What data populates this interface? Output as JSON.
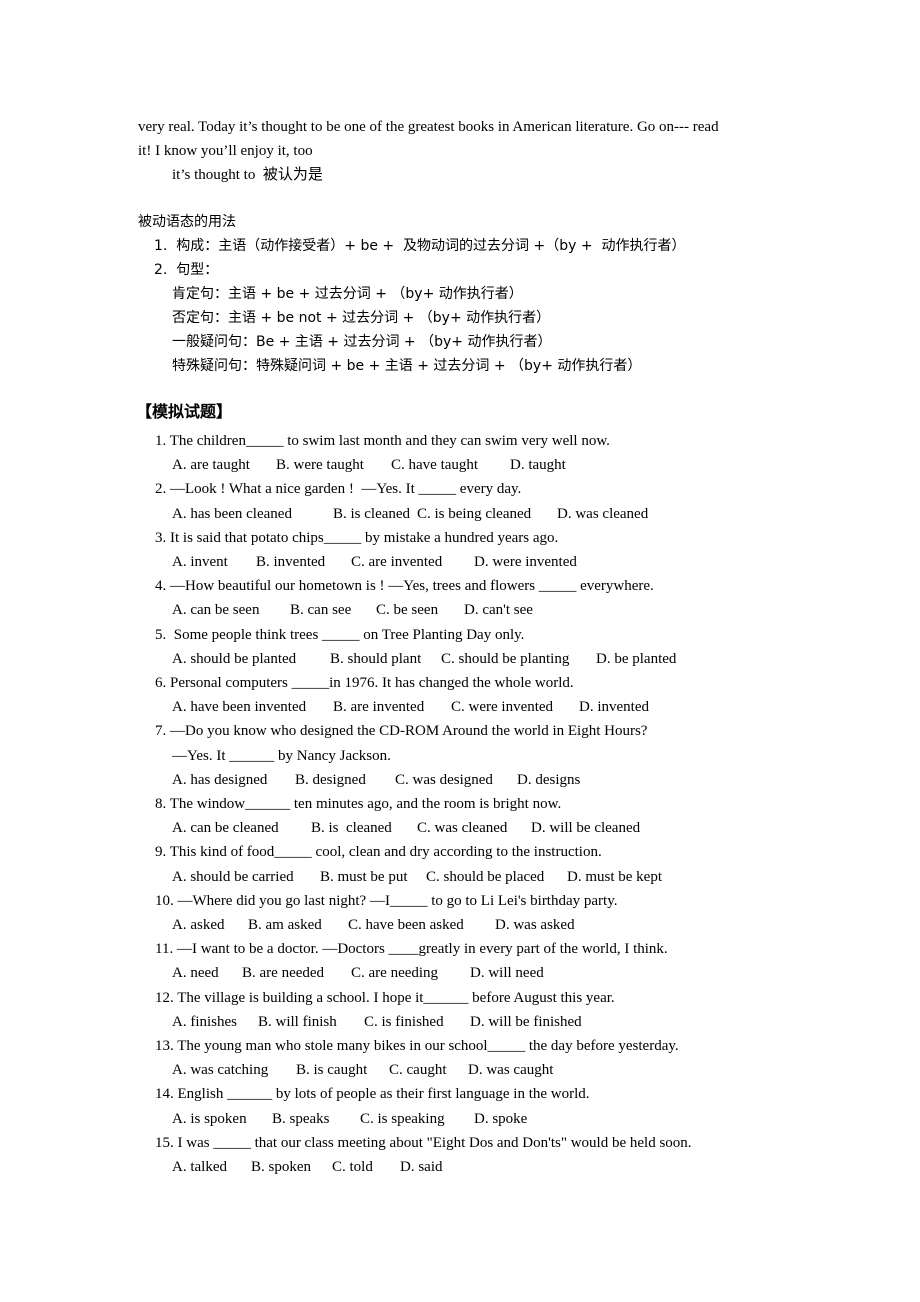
{
  "intro": {
    "line1": "very real. Today it’s thought to be one of the greatest books in American literature. Go on--- read",
    "line2": "it! I know you’ll enjoy it, too",
    "phrase": "it’s thought to  被认为是"
  },
  "grammar": {
    "title": "被动语态的用法",
    "item1": "1.  构成：主语（动作接受者）+ be +  及物动词的过去分词 +（by +  动作执行者）",
    "item2": "2.  句型：",
    "patterns": [
      "肯定句：主语 + be + 过去分词 + （by+ 动作执行者）",
      "否定句：主语 + be not + 过去分词 + （by+ 动作执行者）",
      "一般疑问句：Be + 主语 + 过去分词 + （by+ 动作执行者）",
      "特殊疑问句：特殊疑问词 + be + 主语 + 过去分词 + （by+ 动作执行者）"
    ]
  },
  "exercise": {
    "title": "【模拟试题】",
    "questions": [
      {
        "q": "1. The children_____ to swim last month and they can swim very well now.",
        "options": [
          "A. are taught",
          "B. were taught",
          "C. have taught",
          "D. taught"
        ]
      },
      {
        "q": "2. —Look ! What a nice garden !  —Yes. It _____ every day.",
        "options": [
          "A. has been cleaned",
          "B. is cleaned",
          "C. is being cleaned",
          "D. was cleaned"
        ]
      },
      {
        "q": "3. It is said that potato chips_____ by mistake a hundred years ago.",
        "options": [
          "A. invent",
          "B. invented",
          "C. are invented",
          "D. were invented"
        ]
      },
      {
        "q": "4. —How beautiful our hometown is ! —Yes, trees and flowers _____ everywhere.",
        "options": [
          "A. can be seen",
          "B. can see",
          "C. be seen",
          "D. can't see"
        ]
      },
      {
        "q": "5.  Some people think trees _____ on Tree Planting Day only.",
        "options": [
          "A. should be planted",
          "B. should plant",
          "C. should be planting",
          "D. be planted"
        ]
      },
      {
        "q": "6. Personal computers _____in 1976. It has changed the whole world.",
        "options": [
          "A. have been invented",
          "B. are invented",
          "C. were invented",
          "D. invented"
        ]
      },
      {
        "q": "7. —Do you know who designed the CD-ROM Around the world in Eight Hours?",
        "q2": "—Yes. It ______ by Nancy Jackson.",
        "options": [
          "A. has designed",
          "B. designed",
          "C. was designed",
          "D. designs"
        ]
      },
      {
        "q": "8. The window______ ten minutes ago, and the room is bright now.",
        "options": [
          "A. can be cleaned",
          "B. is  cleaned",
          "C. was cleaned",
          "D. will be cleaned"
        ]
      },
      {
        "q": "9. This kind of food_____ cool, clean and dry according to the instruction.",
        "options": [
          "A. should be carried",
          "B. must be put",
          "C. should be placed",
          "D. must be kept"
        ]
      },
      {
        "q": "10. —Where did you go last night? —I_____ to go to Li Lei's birthday party.",
        "options": [
          "A. asked",
          "B. am asked",
          "C. have been asked",
          "D. was asked"
        ]
      },
      {
        "q": "11. —I want to be a doctor. —Doctors ____greatly in every part of the world, I think.",
        "options": [
          "A. need",
          "B. are needed",
          "C. are needing",
          "D. will need"
        ]
      },
      {
        "q": "12. The village is building a school. I hope it______ before August this year.",
        "options": [
          "A. finishes",
          "B. will finish",
          "C. is finished",
          "D. will be finished"
        ]
      },
      {
        "q": "13. The young man who stole many bikes in our school_____ the day before yesterday.",
        "options": [
          "A. was catching",
          "B. is caught",
          "C. caught",
          "D. was caught"
        ]
      },
      {
        "q": "14. English ______ by lots of people as their first language in the world.",
        "options": [
          "A. is spoken",
          "B. speaks",
          "C. is speaking",
          "D. spoke"
        ]
      },
      {
        "q": "15. I was _____ that our class meeting about \"Eight Dos and Don'ts\" would be held soon.",
        "options": [
          "A. talked",
          "B. spoken",
          "C. told",
          "D. said"
        ]
      }
    ]
  }
}
